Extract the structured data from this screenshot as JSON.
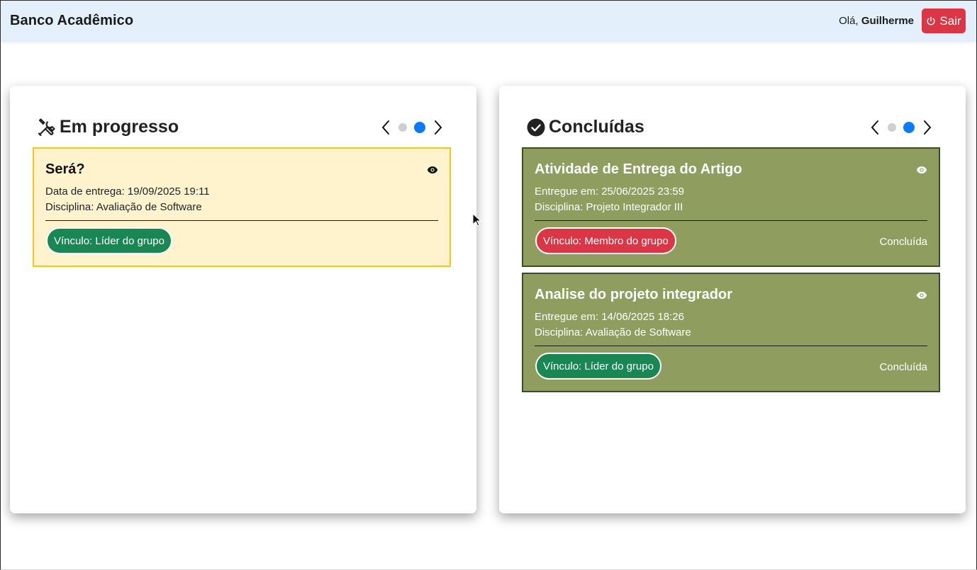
{
  "header": {
    "brand": "Banco Acadêmico",
    "greeting_prefix": "Olá,",
    "user_name": "Guilherme",
    "logout_label": "Sair"
  },
  "in_progress": {
    "title": "Em progresso",
    "icon": "tools-icon",
    "pager": {
      "pages": 2,
      "current": 2
    },
    "cards": [
      {
        "title": "Será?",
        "line1": "Data de entrega: 19/09/2025 19:11",
        "line2": "Disciplina: Avaliação de Software",
        "badge": "Vínculo: Líder do grupo"
      }
    ]
  },
  "completed": {
    "title": "Concluídas",
    "icon": "check-circle-icon",
    "pager": {
      "pages": 2,
      "current": 2
    },
    "cards": [
      {
        "title": "Atividade de Entrega do Artigo",
        "line1": "Entregue em: 25/06/2025 23:59",
        "line2": "Disciplina: Projeto Integrador III",
        "badge": "Vínculo: Membro do grupo",
        "status": "Concluída"
      },
      {
        "title": "Analise do projeto integrador",
        "line1": "Entregue em: 14/06/2025 18:26",
        "line2": "Disciplina: Avaliação de Software",
        "badge": "Vínculo: Líder do grupo",
        "status": "Concluída"
      }
    ]
  },
  "colors": {
    "navbar_bg": "#e3f0fc",
    "logout_bg": "#dc3545",
    "pending_card_bg": "#fff3cd",
    "pending_card_border": "#f5c518",
    "done_card_bg": "#8f9d5e",
    "badge_leader": "#198754",
    "badge_member": "#dc3545",
    "pager_active": "#0d7bff"
  }
}
